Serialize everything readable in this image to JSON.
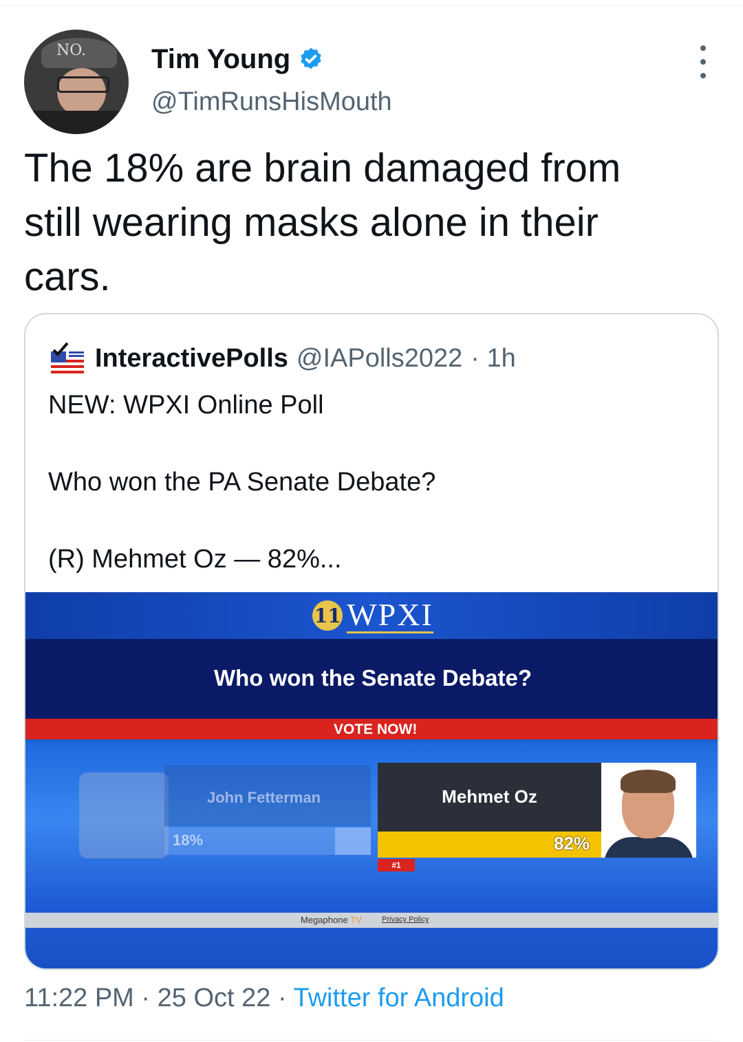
{
  "author": {
    "name": "Tim Young",
    "handle": "@TimRunsHisMouth",
    "avatar_cap_text": "NO."
  },
  "tweet": {
    "text_line1": "The 18% are brain damaged from",
    "text_line2": "still wearing masks alone in their",
    "text_line3": "cars.",
    "time": "11:22 PM",
    "sep1": " · ",
    "date": "25 Oct 22",
    "sep2": " · ",
    "source": "Twitter for Android"
  },
  "quoted": {
    "name": "InteractivePolls",
    "handle": "@IAPolls2022",
    "age": "· 1h",
    "text": "NEW: WPXI Online Poll\n\nWho won the PA Senate Debate?\n\n(R) Mehmet Oz — 82%..."
  },
  "poll_image": {
    "station": "WPXI",
    "station_logo": "11",
    "question": "Who won the Senate Debate?",
    "vote_label": "VOTE NOW!",
    "candidate_left": {
      "name": "John Fetterman",
      "pct": "18%",
      "share": 0.18
    },
    "candidate_right": {
      "name": "Mehmet Oz",
      "pct": "82%",
      "rank": "#1",
      "share": 0.82
    },
    "footer_brand": "Megaphone",
    "footer_brand_suffix": "TV",
    "footer_link": "Privacy Policy"
  },
  "icons": {
    "verified": "verified-badge-icon",
    "more": "more-options-icon",
    "poll_logo": "interactivepolls-flag-logo"
  },
  "colors": {
    "link": "#1d9bf0",
    "secondary_text": "#536471",
    "oz_bar": "#f4c300",
    "vote_bar": "#d9231e"
  }
}
